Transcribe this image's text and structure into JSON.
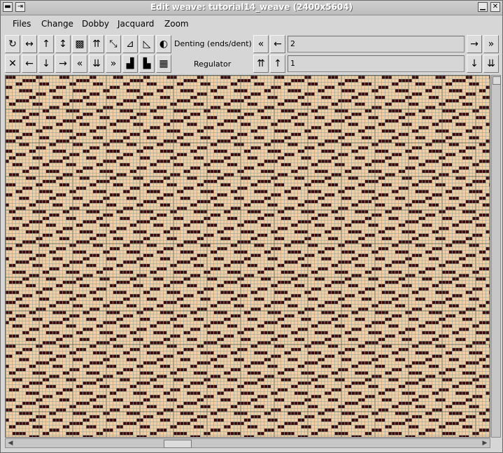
{
  "window": {
    "title": "Edit weave: tutorial14_weave (2400x5604)"
  },
  "titlebar_buttons": {
    "menu_glyph": "▬",
    "pin_glyph": "⇥",
    "minimize_glyph": "▁",
    "close_glyph": "✕"
  },
  "menu": {
    "files": "Files",
    "change": "Change",
    "dobby": "Dobby",
    "jacquard": "Jacquard",
    "zoom": "Zoom"
  },
  "toolbar": {
    "row1_icons": [
      {
        "name": "rotate-icon",
        "glyph": "↻"
      },
      {
        "name": "flip-horizontal-icon",
        "glyph": "↔"
      },
      {
        "name": "shift-up-icon",
        "glyph": "↑"
      },
      {
        "name": "flip-vertical-icon",
        "glyph": "↕"
      },
      {
        "name": "invert-pattern-icon",
        "glyph": "▩"
      },
      {
        "name": "double-up-icon",
        "glyph": "⇈"
      },
      {
        "name": "diagonal-arrows-icon",
        "glyph": "⤡"
      },
      {
        "name": "step-up-icon",
        "glyph": "⊿"
      },
      {
        "name": "step-down-icon",
        "glyph": "◺"
      },
      {
        "name": "half-circle-icon",
        "glyph": "◐"
      }
    ],
    "row2_icons": [
      {
        "name": "clear-icon",
        "glyph": "✕"
      },
      {
        "name": "shift-left-icon",
        "glyph": "←"
      },
      {
        "name": "shift-down-icon",
        "glyph": "↓"
      },
      {
        "name": "shift-right-icon",
        "glyph": "→"
      },
      {
        "name": "double-left-icon",
        "glyph": "«"
      },
      {
        "name": "double-down-icon",
        "glyph": "⇊"
      },
      {
        "name": "double-right-icon",
        "glyph": "»"
      },
      {
        "name": "stairs-up-icon",
        "glyph": "▟"
      },
      {
        "name": "stairs-down-icon",
        "glyph": "▙"
      },
      {
        "name": "checker-icon",
        "glyph": "▦"
      }
    ],
    "denting_label": "Denting (ends/dent)",
    "denting_value": "2",
    "regulator_label": "Regulator",
    "regulator_value": "1",
    "nav": {
      "double_left": "«",
      "left": "←",
      "double_up": "⇈",
      "up": "↑",
      "right": "→",
      "double_right": "»",
      "down": "↓",
      "double_down": "⇊"
    }
  },
  "scrollbars": {
    "up_glyph": "▲",
    "left_glyph": "◀",
    "right_glyph": "▶"
  },
  "colors": {
    "cell_empty": "#f2cfa4",
    "cell_filled": "#3a0a0a",
    "grid_line": "#9aa59a",
    "grid_major": "#6c7a6c"
  }
}
